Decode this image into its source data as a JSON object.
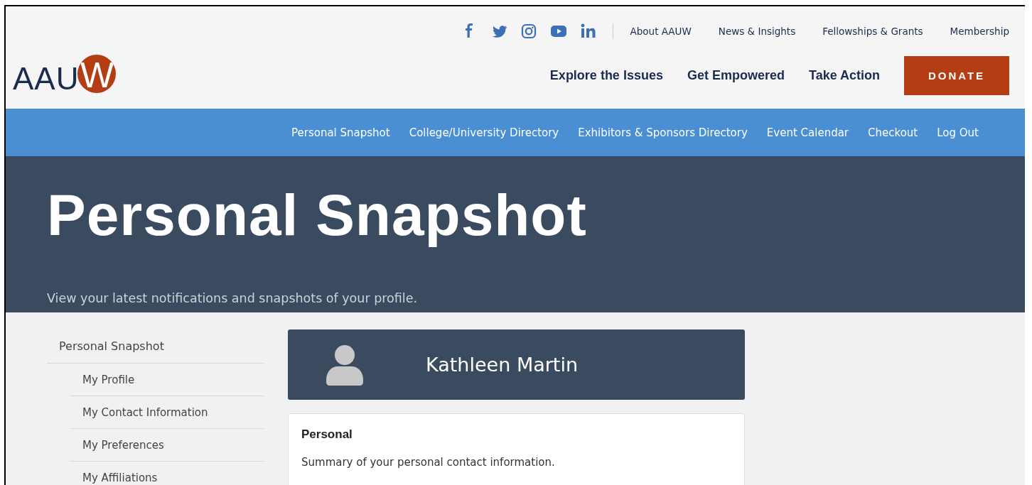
{
  "logo": {
    "text": "AAU",
    "mark": "W"
  },
  "social": [
    {
      "kind": "facebook"
    },
    {
      "kind": "twitter"
    },
    {
      "kind": "instagram"
    },
    {
      "kind": "youtube"
    },
    {
      "kind": "linkedin"
    }
  ],
  "utility_nav": [
    "About AAUW",
    "News & Insights",
    "Fellowships & Grants",
    "Membership"
  ],
  "main_nav": [
    "Explore the Issues",
    "Get Empowered",
    "Take Action"
  ],
  "donate_button": "DONATE",
  "sub_nav": [
    "Personal Snapshot",
    "College/University Directory",
    "Exhibitors & Sponsors Directory",
    "Event Calendar",
    "Checkout",
    "Log Out"
  ],
  "hero": {
    "title": "Personal Snapshot",
    "subtitle": "View your latest notifications and snapshots of your profile."
  },
  "sidebar": {
    "title": "Personal Snapshot",
    "items": [
      "My Profile",
      "My Contact Information",
      "My Preferences",
      "My Affiliations"
    ]
  },
  "profile": {
    "name": "Kathleen Martin"
  },
  "card": {
    "title": "Personal",
    "text": "Summary of your personal contact information."
  }
}
